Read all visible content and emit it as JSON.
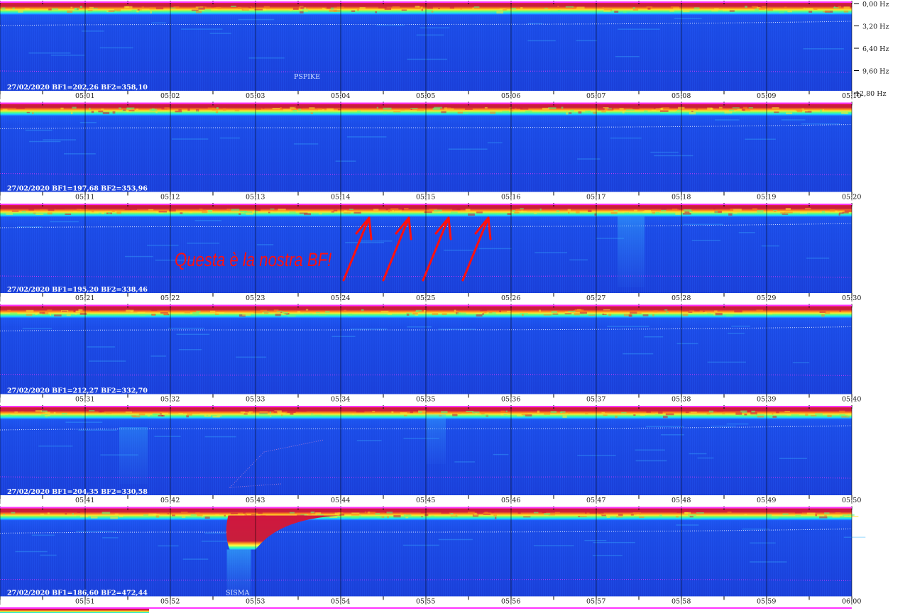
{
  "chart_data": {
    "type": "heatmap",
    "title": "",
    "date": "27/02/2020",
    "colors": {
      "background": "#1a3fd8",
      "hot": "#c81e3c",
      "marker": "#ff33ff",
      "annotation": "#ff1010"
    },
    "frequency_axis": {
      "unit": "Hz",
      "ticks": [
        "0,00 Hz",
        "3,20 Hz",
        "6,40 Hz",
        "9,60 Hz",
        "12,80 Hz"
      ],
      "range": [
        0,
        12.8
      ]
    },
    "rows": [
      {
        "label": "27/02/2020 BF1=202,26 BF2=358,10",
        "bf1": 202.26,
        "bf2": 358.1,
        "times": [
          "05:01",
          "05:02",
          "05:03",
          "05:04",
          "05:05",
          "05:06",
          "05:07",
          "05:08",
          "05:09",
          "05:10"
        ],
        "events": [
          {
            "label": "PSPIKE",
            "time": "05:03.6"
          }
        ]
      },
      {
        "label": "27/02/2020 BF1=197,68 BF2=353,96",
        "bf1": 197.68,
        "bf2": 353.96,
        "times": [
          "05:11",
          "05:12",
          "05:13",
          "05:14",
          "05:15",
          "05:16",
          "05:17",
          "05:18",
          "05:19",
          "05:20"
        ],
        "events": []
      },
      {
        "label": "27/02/2020 BF1=195,20 BF2=338,46",
        "bf1": 195.2,
        "bf2": 338.46,
        "times": [
          "05:21",
          "05:22",
          "05:23",
          "05:24",
          "05:25",
          "05:26",
          "05:27",
          "05:28",
          "05:29",
          "05:30"
        ],
        "events": []
      },
      {
        "label": "27/02/2020 BF1=212,27 BF2=332,70",
        "bf1": 212.27,
        "bf2": 332.7,
        "times": [
          "05:31",
          "05:32",
          "05:33",
          "05:34",
          "05:35",
          "05:36",
          "05:37",
          "05:38",
          "05:39",
          "05:40"
        ],
        "events": []
      },
      {
        "label": "27/02/2020 BF1=204,35 BF2=330,58",
        "bf1": 204.35,
        "bf2": 330.58,
        "times": [
          "05:41",
          "05:42",
          "05:43",
          "05:44",
          "05:45",
          "05:46",
          "05:47",
          "05:48",
          "05:49",
          "05:50"
        ],
        "events": []
      },
      {
        "label": "27/02/2020 BF1=186,60 BF2=472,44",
        "bf1": 186.6,
        "bf2": 472.44,
        "times": [
          "05:51",
          "05:52",
          "05:53",
          "05:54",
          "05:55",
          "05:56",
          "05:57",
          "05:58",
          "05:59",
          "06:00"
        ],
        "events": [
          {
            "label": "SISMA",
            "time": "05:52.8"
          }
        ]
      }
    ],
    "annotation": {
      "text": "Questa è la nostra BF!",
      "row": 3,
      "arrow_count": 4
    }
  }
}
